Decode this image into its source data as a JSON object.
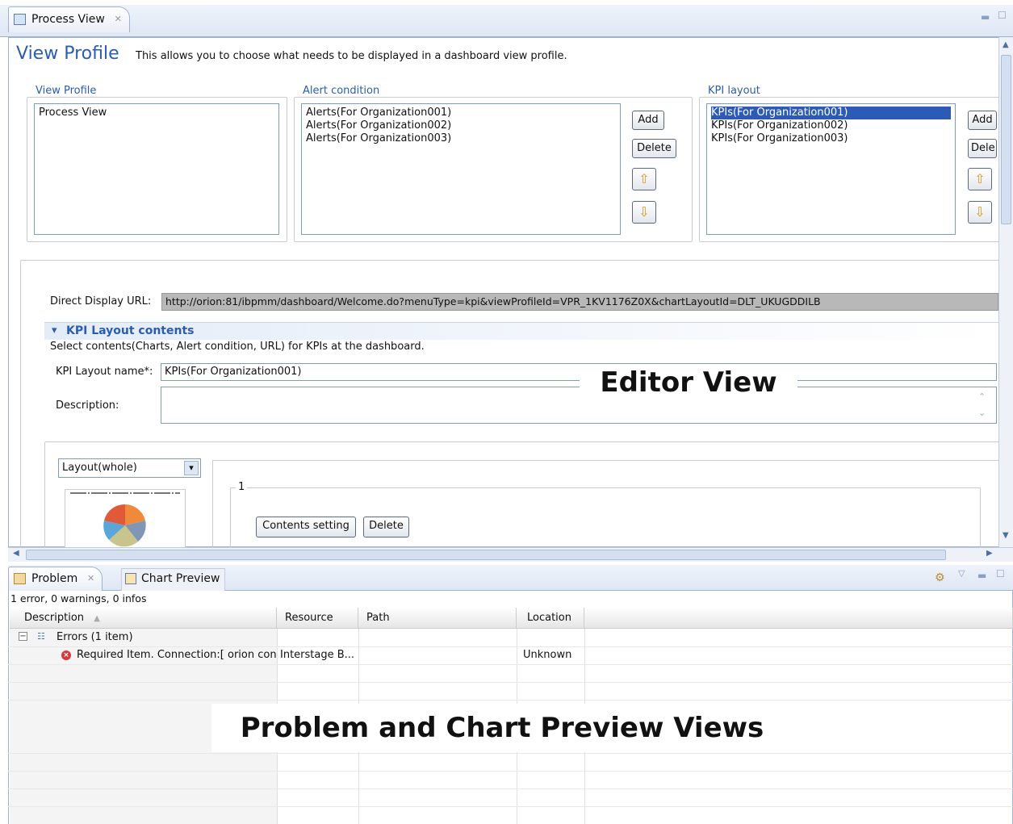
{
  "editor_tab": {
    "title": "Process View",
    "close": "✕"
  },
  "header": {
    "title": "View Profile",
    "description": "This allows you to choose what needs to be displayed in a dashboard view profile."
  },
  "view_profile": {
    "label": "View Profile",
    "items": [
      "Process View"
    ]
  },
  "alert_condition": {
    "label": "Alert condition",
    "items": [
      "Alerts(For Organization001)",
      "Alerts(For Organization002)",
      "Alerts(For Organization003)"
    ],
    "add": "Add",
    "delete": "Delete"
  },
  "kpi_layout": {
    "label": "KPI layout",
    "items": [
      "KPIs(For Organization001)",
      "KPIs(For Organization002)",
      "KPIs(For Organization003)"
    ],
    "add": "Add",
    "delete": "Dele"
  },
  "direct_url": {
    "label": "Direct Display URL:",
    "value": "http://orion:81/ibpmm/dashboard/Welcome.do?menuType=kpi&viewProfileId=VPR_1KV1176Z0X&chartLayoutId=DLT_UKUGDDILB"
  },
  "kpi_section": {
    "title": "KPI Layout contents",
    "description": "Select contents(Charts, Alert condition, URL) for KPIs at the dashboard.",
    "name_label": "KPI Layout name*:",
    "name_value": "KPIs(For Organization001)",
    "desc_label": "Description:"
  },
  "layout": {
    "select_value": "Layout(whole)",
    "group_number": "1",
    "contents_setting": "Contents setting",
    "delete": "Delete"
  },
  "overlay_editor": "Editor View",
  "bottom_tabs": {
    "problem": "Problem",
    "chart_preview": "Chart Preview"
  },
  "problems": {
    "summary": "1 error, 0 warnings, 0 infos",
    "columns": [
      "Description",
      "Resource",
      "Path",
      "Location"
    ],
    "group": "Errors (1 item)",
    "rows": [
      {
        "description": "Required Item. Connection:[ orion con",
        "resource": "Interstage B...",
        "path": "",
        "location": "Unknown"
      }
    ]
  },
  "overlay_bottom": "Problem and Chart Preview Views"
}
